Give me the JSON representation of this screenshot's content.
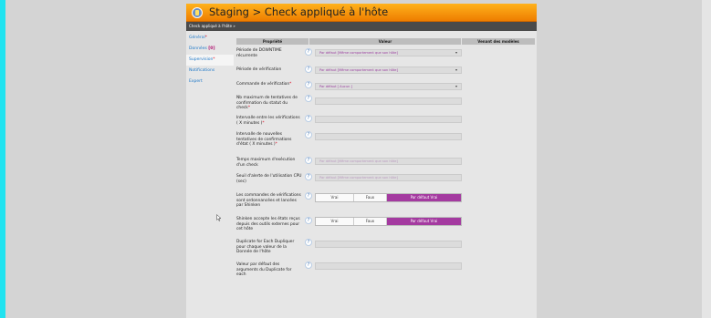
{
  "window": {
    "title": "Staging > Check appliqué à l'hôte",
    "breadcrumb": "Check appliqué à l'hôte »"
  },
  "sidebar": {
    "items": [
      {
        "label": "Général",
        "mark": "*"
      },
      {
        "label": "Données",
        "badge": "[0]"
      },
      {
        "label": "Supervision",
        "mark": "*"
      },
      {
        "label": "Notifications"
      },
      {
        "label": "Expert"
      }
    ]
  },
  "table": {
    "headers": [
      "Propriété",
      "Valeur",
      "Venant des modèles"
    ]
  },
  "help_glyph": "?",
  "caret_glyph": "▾",
  "rows": [
    {
      "label": "Période de DOWNTIME récurrente",
      "value": "Par défaut [Même comportement que son hôte]"
    },
    {
      "label": "Période de vérification",
      "value": "Par défaut [Même comportement que son hôte]"
    },
    {
      "label": "Commande de vérification",
      "req": "*",
      "value": "Par défaut [ Aucun ]"
    },
    {
      "label": "Nb maximum de tentatives de confirmation du statut du check",
      "req": "*"
    },
    {
      "label": "Intervalle entre les vérifications ( X minutes )",
      "req": "*"
    },
    {
      "label": "Intervalle de nouvelles tentatives de confirmations d'état ( X minutes )",
      "req": "*"
    },
    {
      "label": "Temps maximum d'exécution d'un check",
      "value": "Par défaut [Même comportement que son hôte]"
    },
    {
      "label": "Seuil d'alerte de l'utilisation CPU (sec)",
      "value": "Par défaut [Même comportement que son hôte]"
    },
    {
      "label": "Les commandes de vérifications sont ordonnancées et lancées par Shinken",
      "options": [
        "Vrai",
        "Faux",
        "Par défaut Vrai"
      ]
    },
    {
      "label": "Shinken accepte les états reçus depuis des outils externes pour cet hôte",
      "options": [
        "Vrai",
        "Faux",
        "Par défaut Vrai"
      ]
    },
    {
      "label": "Duplicate for Each Dupliquer pour chaque valeur de la Donnée de l'hôte"
    },
    {
      "label": "Valeur par défaut des arguments du Duplicate for each"
    }
  ],
  "colors": {
    "title_bar": "#f39200",
    "accent": "#a43aa0",
    "left_strip": "#21e3f0"
  }
}
